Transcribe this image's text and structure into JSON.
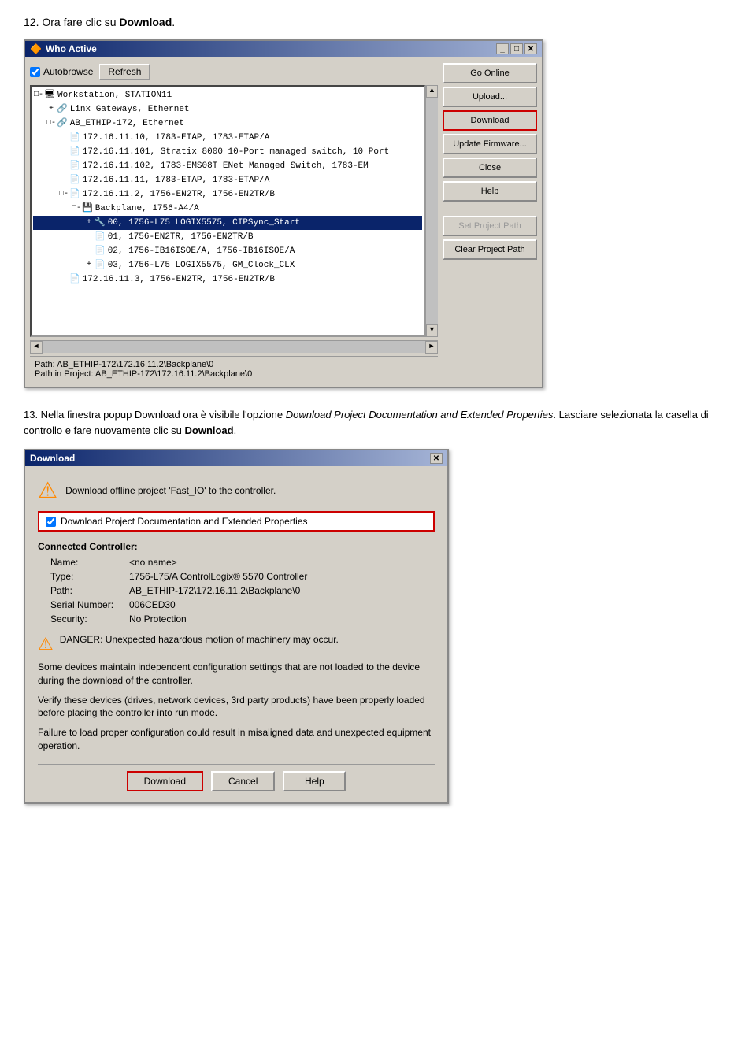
{
  "step12": {
    "heading": "12. Ora fare clic su ",
    "heading_bold": "Download",
    "heading_end": "."
  },
  "step13": {
    "text_pre": "13. Nella finestra popup Download ora è visibile l'opzione ",
    "text_italic": "Download Project Documentation and Extended Properties",
    "text_post": ". Lasciare selezionata la casella di controllo e fare nuovamente clic su ",
    "text_bold": "Download",
    "text_end": "."
  },
  "who_active": {
    "title": "Who Active",
    "autobrowse_label": "Autobrowse",
    "refresh_label": "Refresh",
    "tree_items": [
      {
        "indent": 0,
        "expand": "□-",
        "icon": "🖥",
        "text": "Workstation, STATION11",
        "selected": false
      },
      {
        "indent": 1,
        "expand": "+",
        "icon": "🔗",
        "text": "Linx Gateways, Ethernet",
        "selected": false
      },
      {
        "indent": 1,
        "expand": "□-",
        "icon": "🔗",
        "text": "AB_ETHIP-172, Ethernet",
        "selected": false
      },
      {
        "indent": 2,
        "expand": " ",
        "icon": "📄",
        "text": "172.16.11.10, 1783-ETAP, 1783-ETAP/A",
        "selected": false
      },
      {
        "indent": 2,
        "expand": " ",
        "icon": "📄",
        "text": "172.16.11.101, Stratix 8000 10-Port managed switch, 10 Port",
        "selected": false
      },
      {
        "indent": 2,
        "expand": " ",
        "icon": "📄",
        "text": "172.16.11.102, 1783-EMS08T ENet Managed Switch, 1783-EM",
        "selected": false
      },
      {
        "indent": 2,
        "expand": " ",
        "icon": "📄",
        "text": "172.16.11.11, 1783-ETAP, 1783-ETAP/A",
        "selected": false
      },
      {
        "indent": 2,
        "expand": "□-",
        "icon": "📄",
        "text": "172.16.11.2, 1756-EN2TR, 1756-EN2TR/B",
        "selected": false
      },
      {
        "indent": 3,
        "expand": "□-",
        "icon": "💾",
        "text": "Backplane, 1756-A4/A",
        "selected": false
      },
      {
        "indent": 4,
        "expand": "+",
        "icon": "🔧",
        "text": "00, 1756-L75 LOGIX5575, CIPSync_Start",
        "selected": true
      },
      {
        "indent": 4,
        "expand": " ",
        "icon": "📄",
        "text": "01, 1756-EN2TR, 1756-EN2TR/B",
        "selected": false
      },
      {
        "indent": 4,
        "expand": " ",
        "icon": "📄",
        "text": "02, 1756-IB16ISOE/A, 1756-IB16ISOE/A",
        "selected": false
      },
      {
        "indent": 4,
        "expand": "+",
        "icon": "📄",
        "text": "03, 1756-L75 LOGIX5575, GM_Clock_CLX",
        "selected": false
      },
      {
        "indent": 2,
        "expand": " ",
        "icon": "📄",
        "text": "172.16.11.3, 1756-EN2TR, 1756-EN2TR/B",
        "selected": false
      }
    ],
    "path_label": "Path:",
    "path_value": "AB_ETHIP-172\\172.16.11.2\\Backplane\\0",
    "path_in_project_label": "Path in Project:",
    "path_in_project_value": "AB_ETHIP-172\\172.16.11.2\\Backplane\\0",
    "buttons": {
      "go_online": "Go Online",
      "upload": "Upload...",
      "download": "Download",
      "update_firmware": "Update Firmware...",
      "close": "Close",
      "help": "Help",
      "set_project_path": "Set Project Path",
      "clear_project_path": "Clear Project Path"
    }
  },
  "download_dialog": {
    "title": "Download",
    "top_text": "Download offline project 'Fast_IO' to the controller.",
    "checkbox_label": "Download Project Documentation and Extended Properties",
    "checkbox_checked": true,
    "connected_controller_label": "Connected Controller:",
    "fields": [
      {
        "label": "Name:",
        "value": "<no name>"
      },
      {
        "label": "Type:",
        "value": "1756-L75/A ControlLogix® 5570 Controller"
      },
      {
        "label": "Path:",
        "value": "AB_ETHIP-172\\172.16.11.2\\Backplane\\0"
      },
      {
        "label": "Serial Number:",
        "value": "006CED30"
      },
      {
        "label": "Security:",
        "value": "No Protection"
      }
    ],
    "warning_text": "DANGER: Unexpected hazardous motion of machinery may occur.",
    "para1": "Some devices maintain independent configuration settings that are not loaded to the device during the download of the controller.",
    "para2": "Verify these devices (drives, network devices, 3rd party products) have been properly loaded before placing the controller into run mode.",
    "para3": "Failure to load proper configuration could result in misaligned data and unexpected equipment operation.",
    "buttons": {
      "download": "Download",
      "cancel": "Cancel",
      "help": "Help"
    }
  }
}
